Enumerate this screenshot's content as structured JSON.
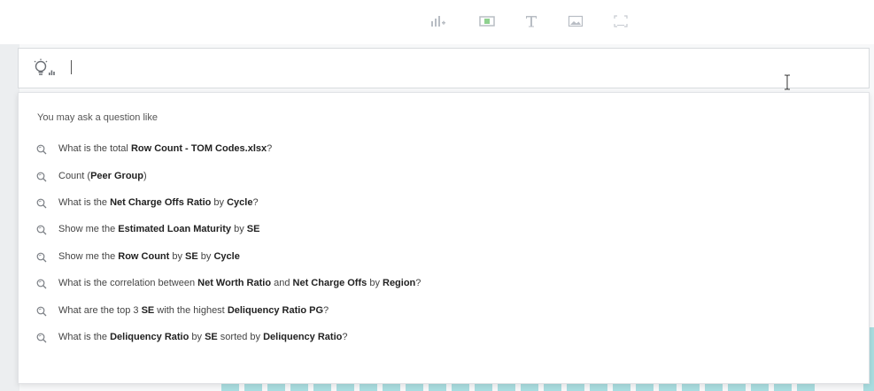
{
  "colors": {
    "accent_teal": "#a9dde0",
    "toolbar_icon_gray": "#b8bdc4",
    "text_dark": "#222222",
    "border": "#d8dbde"
  },
  "toolbar": {
    "icons": [
      "add-chart-icon",
      "insert-widget-icon",
      "text-icon",
      "image-icon",
      "expand-icon"
    ]
  },
  "ask_bar": {
    "value": "",
    "icon": "lightbulb-chart-icon"
  },
  "dropdown": {
    "hint": "You may ask a question like",
    "suggestions": [
      [
        {
          "t": "What is the total "
        },
        {
          "t": "Row Count - TOM Codes.xlsx",
          "b": true
        },
        {
          "t": "?"
        }
      ],
      [
        {
          "t": "Count ("
        },
        {
          "t": "Peer Group",
          "b": true
        },
        {
          "t": ")"
        }
      ],
      [
        {
          "t": "What is the "
        },
        {
          "t": "Net Charge Offs Ratio",
          "b": true
        },
        {
          "t": " by "
        },
        {
          "t": "Cycle",
          "b": true
        },
        {
          "t": "?"
        }
      ],
      [
        {
          "t": "Show me the "
        },
        {
          "t": "Estimated Loan Maturity",
          "b": true
        },
        {
          "t": " by "
        },
        {
          "t": "SE",
          "b": true
        }
      ],
      [
        {
          "t": "Show me the "
        },
        {
          "t": "Row Count",
          "b": true
        },
        {
          "t": " by "
        },
        {
          "t": "SE",
          "b": true
        },
        {
          "t": " by "
        },
        {
          "t": "Cycle",
          "b": true
        }
      ],
      [
        {
          "t": "What is the correlation between "
        },
        {
          "t": "Net Worth Ratio",
          "b": true
        },
        {
          "t": " and "
        },
        {
          "t": "Net Charge Offs",
          "b": true
        },
        {
          "t": " by "
        },
        {
          "t": "Region",
          "b": true
        },
        {
          "t": "?"
        }
      ],
      [
        {
          "t": "What are the top 3 "
        },
        {
          "t": "SE",
          "b": true
        },
        {
          "t": " with the highest "
        },
        {
          "t": "Deliquency Ratio PG",
          "b": true
        },
        {
          "t": "?"
        }
      ],
      [
        {
          "t": "What is the "
        },
        {
          "t": "Deliquency Ratio",
          "b": true
        },
        {
          "t": " by "
        },
        {
          "t": "SE",
          "b": true
        },
        {
          "t": " sorted by "
        },
        {
          "t": "Deliquency Ratio",
          "b": true
        },
        {
          "t": "?"
        }
      ]
    ]
  }
}
